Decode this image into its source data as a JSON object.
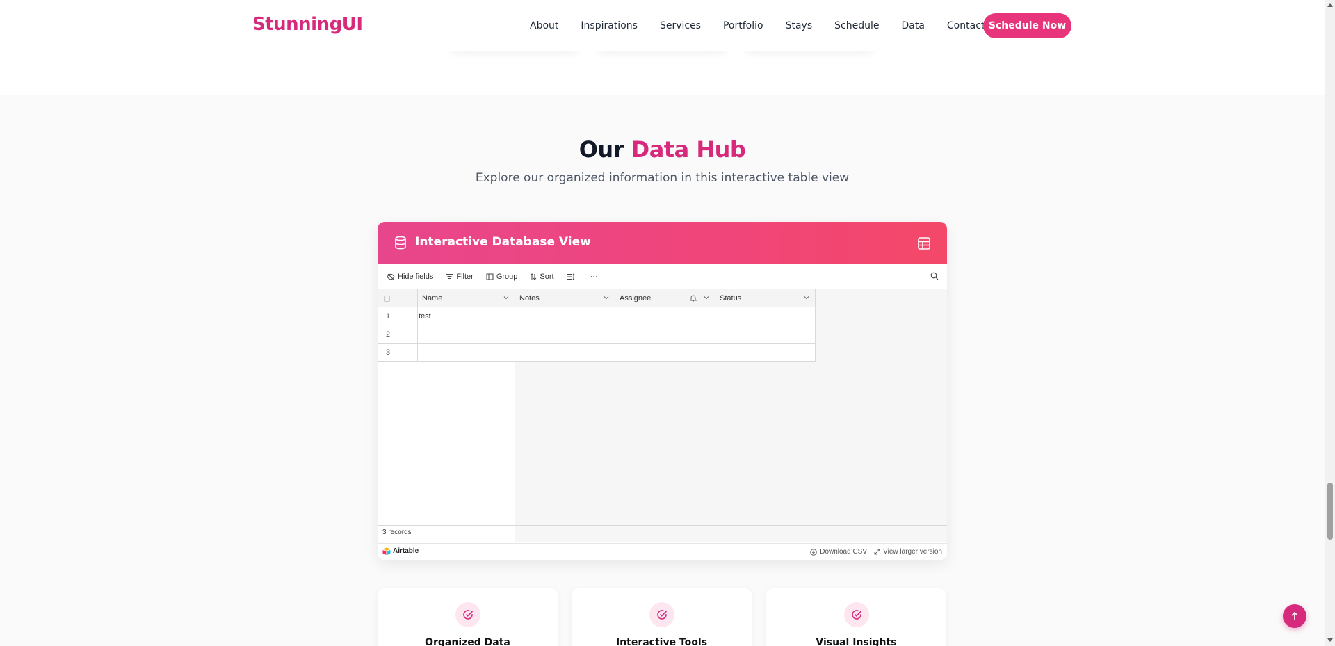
{
  "header": {
    "logo": "StunningUI",
    "nav": [
      "About",
      "Inspirations",
      "Services",
      "Portfolio",
      "Stays",
      "Schedule",
      "Data",
      "Contact"
    ],
    "cta": "Schedule Now"
  },
  "section": {
    "title_prefix": "Our",
    "title_accent": "Data Hub",
    "subtitle": "Explore our organized information in this interactive table view"
  },
  "db": {
    "title": "Interactive Database View",
    "toolbar": {
      "hide_fields": "Hide fields",
      "filter": "Filter",
      "group": "Group",
      "sort": "Sort",
      "more": "···"
    },
    "columns": [
      "Name",
      "Notes",
      "Assignee",
      "Status"
    ],
    "rows": [
      {
        "num": "1",
        "name": "test",
        "notes": "",
        "assignee": "",
        "status": ""
      },
      {
        "num": "2",
        "name": "",
        "notes": "",
        "assignee": "",
        "status": ""
      },
      {
        "num": "3",
        "name": "",
        "notes": "",
        "assignee": "",
        "status": ""
      }
    ],
    "records": "3 records",
    "brand": "Airtable",
    "download": "Download CSV",
    "view_larger": "View larger version"
  },
  "features": [
    "Organized Data",
    "Interactive Tools",
    "Visual Insights"
  ],
  "colors": {
    "accent": "#d62a7d",
    "cta": "#e8347a",
    "header_gradient_start": "#e8468c",
    "header_gradient_end": "#f44869"
  }
}
